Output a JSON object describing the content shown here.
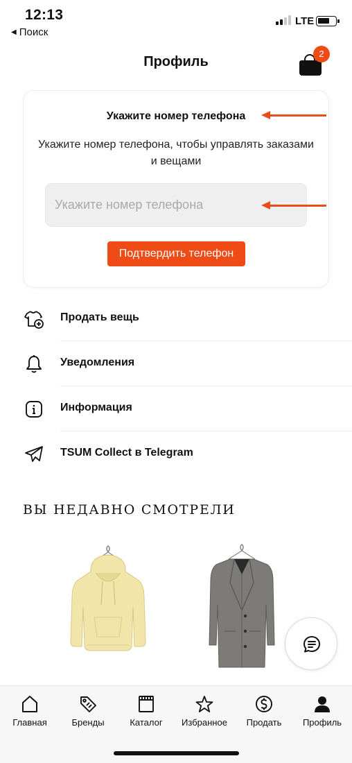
{
  "status_bar": {
    "time": "12:13",
    "back_label": "Поиск",
    "network": "LTE"
  },
  "header": {
    "title": "Профиль",
    "cart_count": "2"
  },
  "phone_card": {
    "title": "Укажите номер телефона",
    "description": "Укажите номер телефона, чтобы управлять заказами и вещами",
    "input_placeholder": "Укажите номер телефона",
    "input_value": "",
    "confirm_label": "Подтвердить телефон"
  },
  "menu": {
    "items": [
      {
        "label": "Продать вещь",
        "icon": "sell-item-icon"
      },
      {
        "label": "Уведомления",
        "icon": "bell-icon"
      },
      {
        "label": "Информация",
        "icon": "info-icon"
      },
      {
        "label": "TSUM Collect в Telegram",
        "icon": "telegram-icon"
      }
    ]
  },
  "recent": {
    "title": "ВЫ НЕДАВНО СМОТРЕЛИ",
    "products": [
      {
        "type": "hoodie",
        "color": "#f0e4a6"
      },
      {
        "type": "coat",
        "color": "#7b7a76"
      }
    ]
  },
  "tab_bar": {
    "tabs": [
      {
        "label": "Главная",
        "icon": "home-icon"
      },
      {
        "label": "Бренды",
        "icon": "tag-icon"
      },
      {
        "label": "Каталог",
        "icon": "catalog-icon"
      },
      {
        "label": "Избранное",
        "icon": "star-icon"
      },
      {
        "label": "Продать",
        "icon": "dollar-icon"
      },
      {
        "label": "Профиль",
        "icon": "profile-icon"
      }
    ],
    "active_index": 5
  },
  "colors": {
    "accent": "#ee4b16",
    "annotation": "#e84d1c",
    "input_bg": "#efefef"
  }
}
